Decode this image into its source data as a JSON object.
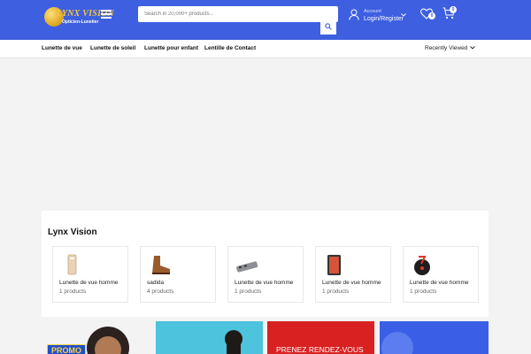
{
  "header": {
    "logo_brand": "LYNX VISION",
    "logo_tagline": "Opticien-Lunetier",
    "search_placeholder": "Search in 20,000+ products...",
    "account_label": "Account",
    "account_action": "Login/Register",
    "wishlist_count": "0",
    "cart_count": "0",
    "accent": "#3d5fe0"
  },
  "nav": {
    "items": [
      "Lunette de vue",
      "Lunette de soleil",
      "Lunette pour enfant",
      "Lentille de Contact"
    ],
    "recent_label": "Recently Viewed"
  },
  "categories": {
    "title": "Lynx Vision",
    "cards": [
      {
        "name": "Lunette de vue homme",
        "count": "1 products",
        "icon": "phone-icon"
      },
      {
        "name": "sadida",
        "count": "4 products",
        "icon": "boot-icon"
      },
      {
        "name": "Lunette de vue homme",
        "count": "1 products",
        "icon": "usb-hub-icon"
      },
      {
        "name": "Lunette de vue homme",
        "count": "1 products",
        "icon": "tablet-icon"
      },
      {
        "name": "Lunette de vue homme",
        "count": "1 products",
        "icon": "smart-speaker-icon"
      }
    ]
  },
  "banners": {
    "promo_label": "PROMO",
    "rdv_label": "PRENEZ RENDEZ-VOUS"
  }
}
